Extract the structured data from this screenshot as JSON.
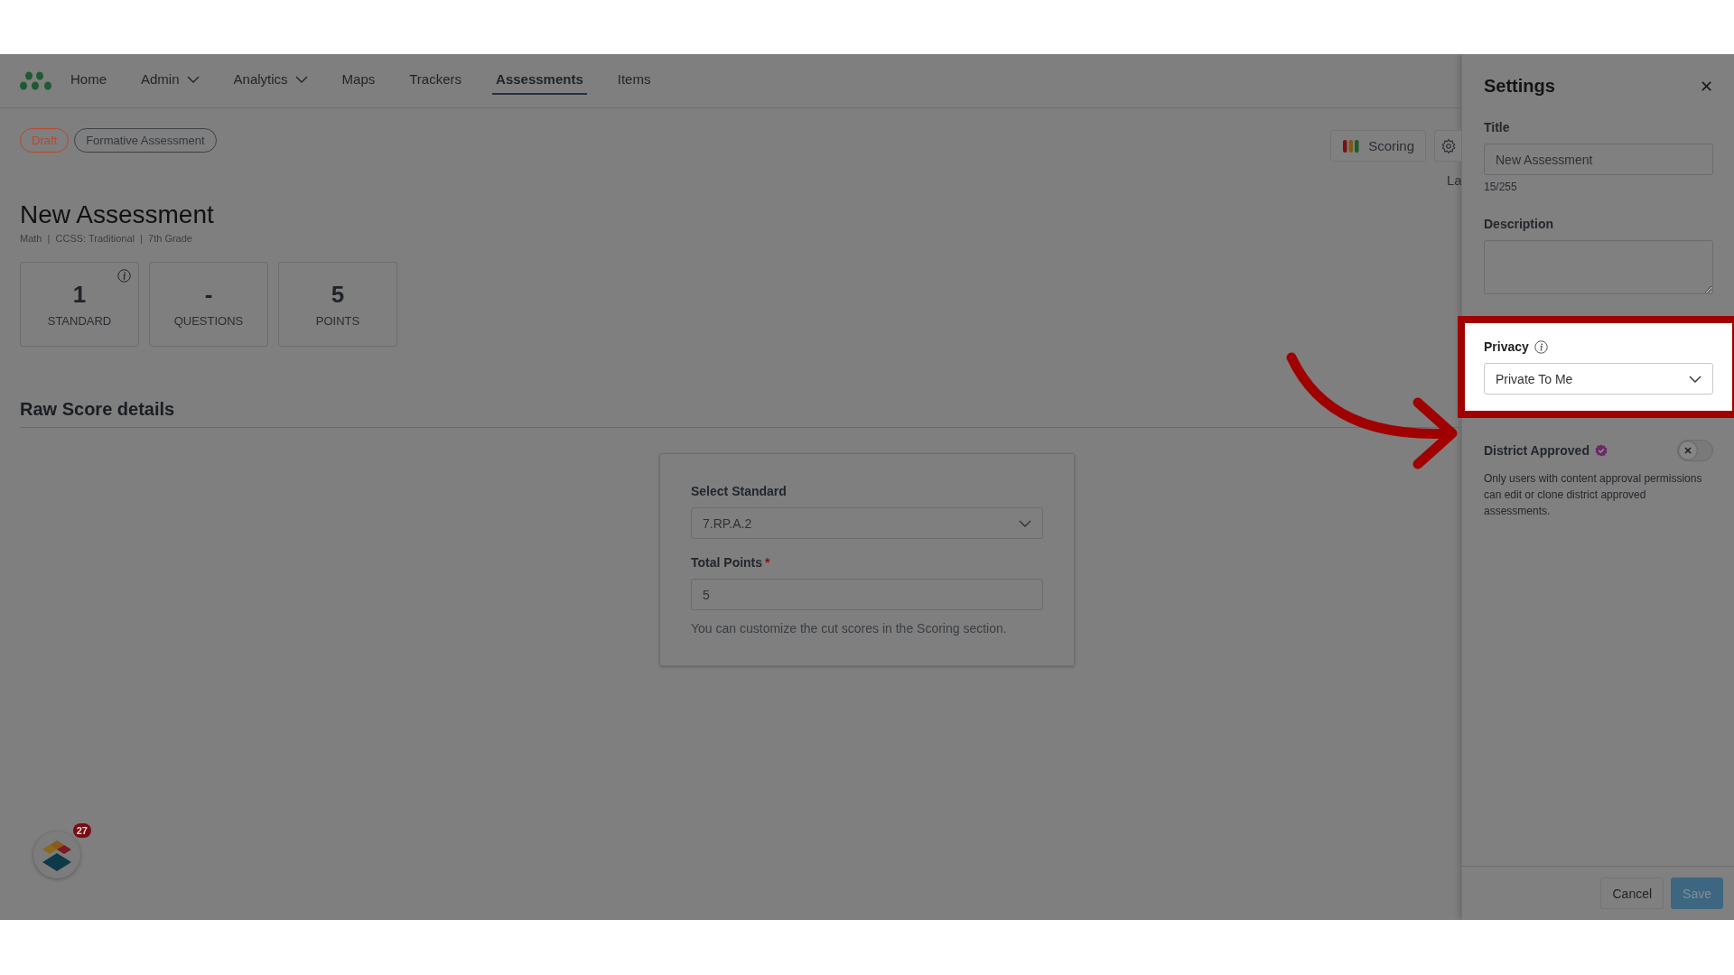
{
  "nav": {
    "items": [
      {
        "label": "Home",
        "has_menu": false,
        "selected": false
      },
      {
        "label": "Admin",
        "has_menu": true,
        "selected": false
      },
      {
        "label": "Analytics",
        "has_menu": true,
        "selected": false
      },
      {
        "label": "Maps",
        "has_menu": false,
        "selected": false
      },
      {
        "label": "Trackers",
        "has_menu": false,
        "selected": false
      },
      {
        "label": "Assessments",
        "has_menu": false,
        "selected": true
      },
      {
        "label": "Items",
        "has_menu": false,
        "selected": false
      }
    ]
  },
  "tags": [
    {
      "label": "Draft",
      "kind": "status"
    },
    {
      "label": "Formative Assessment",
      "kind": "type"
    }
  ],
  "toolbar": {
    "scoring_button": "Scoring",
    "cut_label": "La"
  },
  "assessment": {
    "title": "New Assessment",
    "meta": "Math  |  CCSS: Traditional  |  7th Grade"
  },
  "stats": [
    {
      "value": "1",
      "label": "STANDARD",
      "info": true
    },
    {
      "value": "-",
      "label": "QUESTIONS",
      "info": false
    },
    {
      "value": "5",
      "label": "POINTS",
      "info": false
    }
  ],
  "raw_score": {
    "heading": "Raw Score details",
    "standard_label": "Select Standard",
    "standard_value": "7.RP.A.2",
    "points_label": "Total Points",
    "required_mark": "*",
    "points_value": "5",
    "hint": "You can customize the cut scores in the Scoring section."
  },
  "widget": {
    "badge": "27"
  },
  "settings": {
    "title": "Settings",
    "close": "✕",
    "title_label": "Title",
    "title_value": "New Assessment",
    "title_count": "15/255",
    "description_label": "Description",
    "privacy": {
      "label": "Privacy",
      "value": "Private To Me",
      "highlighted": true
    },
    "district": {
      "label": "District Approved",
      "on": false,
      "note": "Only users with content approval permissions can edit or clone district approved assessments."
    },
    "buttons": [
      {
        "label": "Cancel",
        "kind": "secondary",
        "disabled": false
      },
      {
        "label": "Save",
        "kind": "primary",
        "disabled": true
      }
    ]
  }
}
